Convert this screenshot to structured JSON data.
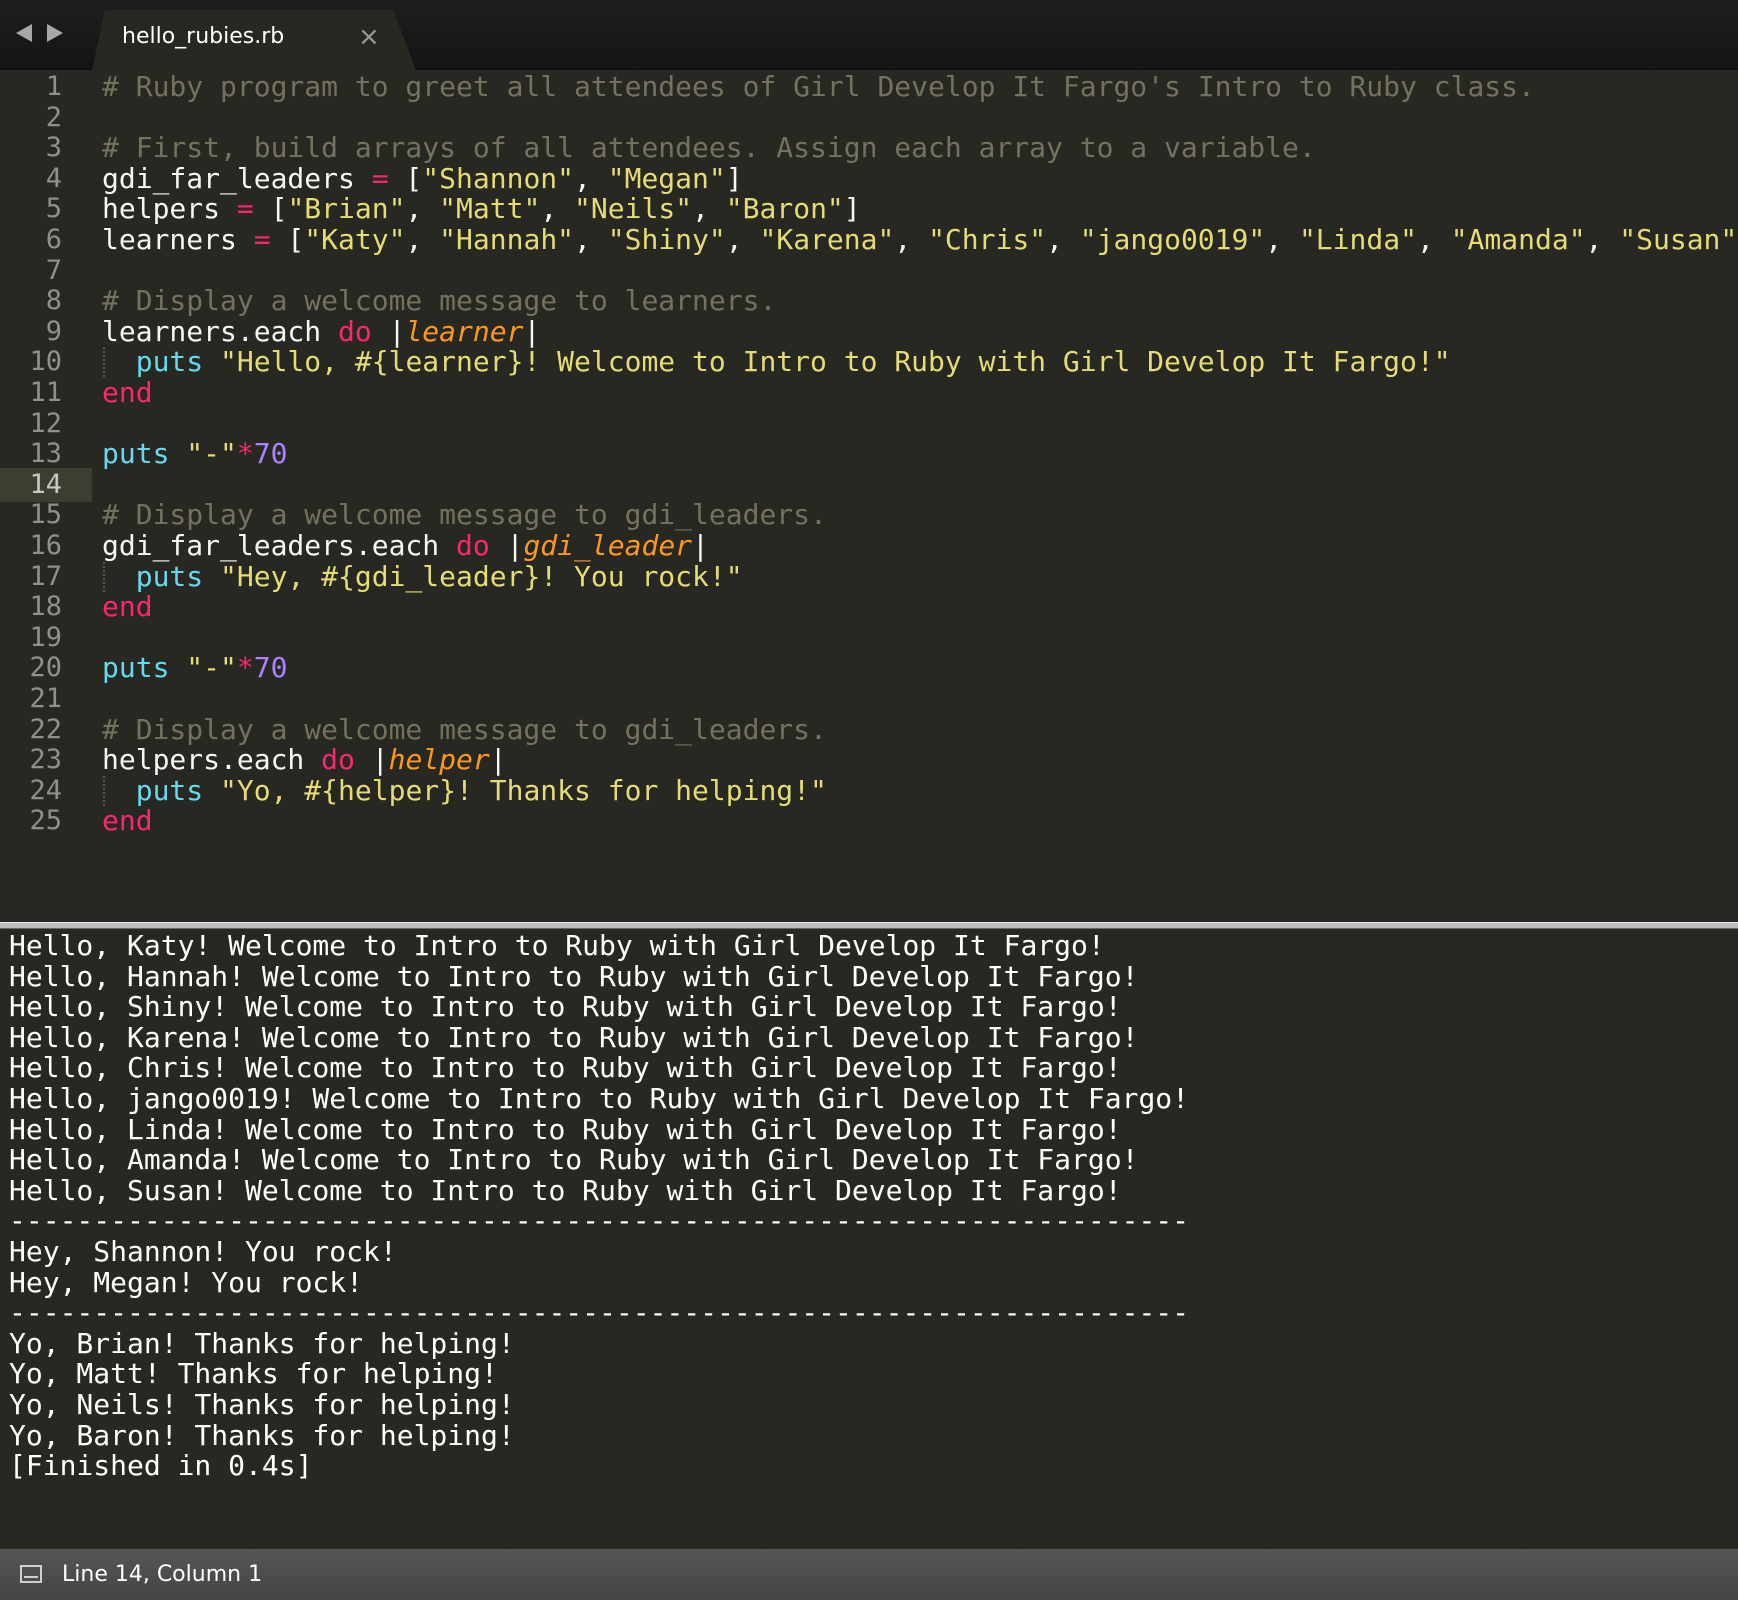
{
  "tab": {
    "title": "hello_rubies.rb",
    "close_glyph": "×"
  },
  "editor": {
    "active_line": 14,
    "lines": [
      {
        "n": "1",
        "tokens": [
          {
            "t": "# Ruby program to greet all attendees of Girl Develop It Fargo's Intro to Ruby class.",
            "c": "cm"
          }
        ]
      },
      {
        "n": "2",
        "tokens": []
      },
      {
        "n": "3",
        "tokens": [
          {
            "t": "# First, build arrays of all attendees. Assign each array to a variable.",
            "c": "cm"
          }
        ]
      },
      {
        "n": "4",
        "tokens": [
          {
            "t": "gdi_far_leaders ",
            "c": ""
          },
          {
            "t": "=",
            "c": "kw"
          },
          {
            "t": " [",
            "c": ""
          },
          {
            "t": "\"Shannon\"",
            "c": "st"
          },
          {
            "t": ", ",
            "c": ""
          },
          {
            "t": "\"Megan\"",
            "c": "st"
          },
          {
            "t": "]",
            "c": ""
          }
        ]
      },
      {
        "n": "5",
        "tokens": [
          {
            "t": "helpers ",
            "c": ""
          },
          {
            "t": "=",
            "c": "kw"
          },
          {
            "t": " [",
            "c": ""
          },
          {
            "t": "\"Brian\"",
            "c": "st"
          },
          {
            "t": ", ",
            "c": ""
          },
          {
            "t": "\"Matt\"",
            "c": "st"
          },
          {
            "t": ", ",
            "c": ""
          },
          {
            "t": "\"Neils\"",
            "c": "st"
          },
          {
            "t": ", ",
            "c": ""
          },
          {
            "t": "\"Baron\"",
            "c": "st"
          },
          {
            "t": "]",
            "c": ""
          }
        ]
      },
      {
        "n": "6",
        "tokens": [
          {
            "t": "learners ",
            "c": ""
          },
          {
            "t": "=",
            "c": "kw"
          },
          {
            "t": " [",
            "c": ""
          },
          {
            "t": "\"Katy\"",
            "c": "st"
          },
          {
            "t": ", ",
            "c": ""
          },
          {
            "t": "\"Hannah\"",
            "c": "st"
          },
          {
            "t": ", ",
            "c": ""
          },
          {
            "t": "\"Shiny\"",
            "c": "st"
          },
          {
            "t": ", ",
            "c": ""
          },
          {
            "t": "\"Karena\"",
            "c": "st"
          },
          {
            "t": ", ",
            "c": ""
          },
          {
            "t": "\"Chris\"",
            "c": "st"
          },
          {
            "t": ", ",
            "c": ""
          },
          {
            "t": "\"jango0019\"",
            "c": "st"
          },
          {
            "t": ", ",
            "c": ""
          },
          {
            "t": "\"Linda\"",
            "c": "st"
          },
          {
            "t": ", ",
            "c": ""
          },
          {
            "t": "\"Amanda\"",
            "c": "st"
          },
          {
            "t": ", ",
            "c": ""
          },
          {
            "t": "\"Susan\"",
            "c": "st"
          },
          {
            "t": "]",
            "c": ""
          }
        ]
      },
      {
        "n": "7",
        "tokens": []
      },
      {
        "n": "8",
        "tokens": [
          {
            "t": "# Display a welcome message to learners.",
            "c": "cm"
          }
        ]
      },
      {
        "n": "9",
        "tokens": [
          {
            "t": "learners.each ",
            "c": ""
          },
          {
            "t": "do",
            "c": "kw"
          },
          {
            "t": " |",
            "c": ""
          },
          {
            "t": "learner",
            "c": "pa"
          },
          {
            "t": "|",
            "c": ""
          }
        ]
      },
      {
        "n": "10",
        "guide": true,
        "tokens": [
          {
            "t": "  ",
            "c": ""
          },
          {
            "t": "puts",
            "c": "fn"
          },
          {
            "t": " ",
            "c": ""
          },
          {
            "t": "\"Hello, #{learner}! Welcome to Intro to Ruby with Girl Develop It Fargo!\"",
            "c": "st"
          }
        ]
      },
      {
        "n": "11",
        "tokens": [
          {
            "t": "end",
            "c": "kw"
          }
        ]
      },
      {
        "n": "12",
        "tokens": []
      },
      {
        "n": "13",
        "tokens": [
          {
            "t": "puts",
            "c": "fn"
          },
          {
            "t": " ",
            "c": ""
          },
          {
            "t": "\"-\"",
            "c": "st"
          },
          {
            "t": "*",
            "c": "kw"
          },
          {
            "t": "70",
            "c": "nu"
          }
        ]
      },
      {
        "n": "14",
        "tokens": []
      },
      {
        "n": "15",
        "tokens": [
          {
            "t": "# Display a welcome message to gdi_leaders.",
            "c": "cm"
          }
        ]
      },
      {
        "n": "16",
        "tokens": [
          {
            "t": "gdi_far_leaders.each ",
            "c": ""
          },
          {
            "t": "do",
            "c": "kw"
          },
          {
            "t": " |",
            "c": ""
          },
          {
            "t": "gdi_leader",
            "c": "pa"
          },
          {
            "t": "|",
            "c": ""
          }
        ]
      },
      {
        "n": "17",
        "guide": true,
        "tokens": [
          {
            "t": "  ",
            "c": ""
          },
          {
            "t": "puts",
            "c": "fn"
          },
          {
            "t": " ",
            "c": ""
          },
          {
            "t": "\"Hey, #{gdi_leader}! You rock!\"",
            "c": "st"
          }
        ]
      },
      {
        "n": "18",
        "tokens": [
          {
            "t": "end",
            "c": "kw"
          }
        ]
      },
      {
        "n": "19",
        "tokens": []
      },
      {
        "n": "20",
        "tokens": [
          {
            "t": "puts",
            "c": "fn"
          },
          {
            "t": " ",
            "c": ""
          },
          {
            "t": "\"-\"",
            "c": "st"
          },
          {
            "t": "*",
            "c": "kw"
          },
          {
            "t": "70",
            "c": "nu"
          }
        ]
      },
      {
        "n": "21",
        "tokens": []
      },
      {
        "n": "22",
        "tokens": [
          {
            "t": "# Display a welcome message to gdi_leaders.",
            "c": "cm"
          }
        ]
      },
      {
        "n": "23",
        "tokens": [
          {
            "t": "helpers.each ",
            "c": ""
          },
          {
            "t": "do",
            "c": "kw"
          },
          {
            "t": " |",
            "c": ""
          },
          {
            "t": "helper",
            "c": "pa"
          },
          {
            "t": "|",
            "c": ""
          }
        ]
      },
      {
        "n": "24",
        "guide": true,
        "tokens": [
          {
            "t": "  ",
            "c": ""
          },
          {
            "t": "puts",
            "c": "fn"
          },
          {
            "t": " ",
            "c": ""
          },
          {
            "t": "\"Yo, #{helper}! Thanks for helping!\"",
            "c": "st"
          }
        ]
      },
      {
        "n": "25",
        "tokens": [
          {
            "t": "end",
            "c": "kw"
          }
        ]
      }
    ]
  },
  "output": {
    "lines": [
      "Hello, Katy! Welcome to Intro to Ruby with Girl Develop It Fargo!",
      "Hello, Hannah! Welcome to Intro to Ruby with Girl Develop It Fargo!",
      "Hello, Shiny! Welcome to Intro to Ruby with Girl Develop It Fargo!",
      "Hello, Karena! Welcome to Intro to Ruby with Girl Develop It Fargo!",
      "Hello, Chris! Welcome to Intro to Ruby with Girl Develop It Fargo!",
      "Hello, jango0019! Welcome to Intro to Ruby with Girl Develop It Fargo!",
      "Hello, Linda! Welcome to Intro to Ruby with Girl Develop It Fargo!",
      "Hello, Amanda! Welcome to Intro to Ruby with Girl Develop It Fargo!",
      "Hello, Susan! Welcome to Intro to Ruby with Girl Develop It Fargo!",
      "----------------------------------------------------------------------",
      "Hey, Shannon! You rock!",
      "Hey, Megan! You rock!",
      "----------------------------------------------------------------------",
      "Yo, Brian! Thanks for helping!",
      "Yo, Matt! Thanks for helping!",
      "Yo, Neils! Thanks for helping!",
      "Yo, Baron! Thanks for helping!",
      "[Finished in 0.4s]"
    ]
  },
  "statusbar": {
    "position": "Line 14, Column 1",
    "panel_icon": "panel-toggle-icon"
  },
  "colors": {
    "background": "#272822",
    "comment": "#75715e",
    "string": "#e6db74",
    "keyword": "#f92672",
    "function": "#66d9ef",
    "number": "#ae81ff",
    "parameter": "#fd971f",
    "text": "#f8f8f2"
  }
}
